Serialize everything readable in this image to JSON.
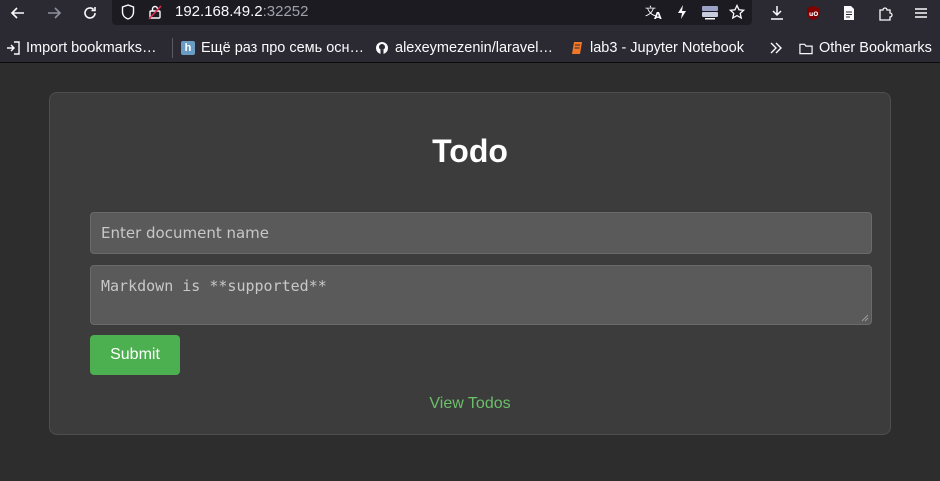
{
  "browser": {
    "url_host": "192.168.49.2",
    "url_port": ":32252",
    "bookmarks": [
      {
        "label": "Import bookmarks…",
        "icon": "import-icon"
      },
      {
        "label": "Ещё раз про семь осн…",
        "icon": "habr-icon"
      },
      {
        "label": "alexeymezenin/laravel…",
        "icon": "github-icon"
      },
      {
        "label": "lab3 - Jupyter Notebook",
        "icon": "notebook-icon"
      }
    ],
    "other_bookmarks": "Other Bookmarks"
  },
  "form": {
    "title": "Todo",
    "name_placeholder": "Enter document name",
    "body_placeholder": "Markdown is **supported**",
    "submit_label": "Submit",
    "view_link": "View Todos"
  },
  "colors": {
    "accent_button": "#4caf50",
    "link": "#6abf69"
  }
}
